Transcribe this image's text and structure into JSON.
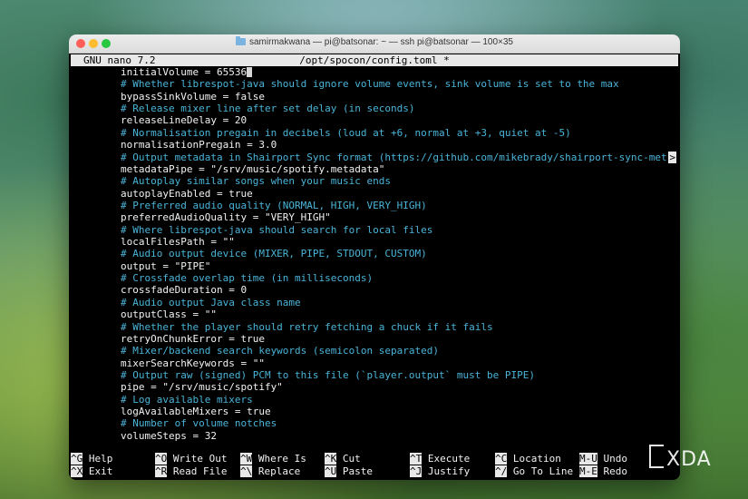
{
  "window": {
    "title": "samirmakwana — pi@batsonar: ~ — ssh pi@batsonar — 100×35"
  },
  "nano": {
    "version": "GNU nano 7.2",
    "filename": "/opt/spocon/config.toml *"
  },
  "lines": [
    {
      "text": "initialVolume = 65536",
      "type": "code",
      "cursor": true
    },
    {
      "text": "# Whether librespot-java should ignore volume events, sink volume is set to the max",
      "type": "comment"
    },
    {
      "text": "bypassSinkVolume = false",
      "type": "code"
    },
    {
      "text": "# Release mixer line after set delay (in seconds)",
      "type": "comment"
    },
    {
      "text": "releaseLineDelay = 20",
      "type": "code"
    },
    {
      "text": "# Normalisation pregain in decibels (loud at +6, normal at +3, quiet at -5)",
      "type": "comment"
    },
    {
      "text": "normalisationPregain = 3.0",
      "type": "code"
    },
    {
      "text": "# Output metadata in Shairport Sync format (https://github.com/mikebrady/shairport-sync-met",
      "type": "comment",
      "overflow": ">"
    },
    {
      "text": "metadataPipe = \"/srv/music/spotify.metadata\"",
      "type": "code"
    },
    {
      "text": "# Autoplay similar songs when your music ends",
      "type": "comment"
    },
    {
      "text": "autoplayEnabled = true",
      "type": "code"
    },
    {
      "text": "# Preferred audio quality (NORMAL, HIGH, VERY_HIGH)",
      "type": "comment"
    },
    {
      "text": "preferredAudioQuality = \"VERY_HIGH\"",
      "type": "code"
    },
    {
      "text": "# Where librespot-java should search for local files",
      "type": "comment"
    },
    {
      "text": "localFilesPath = \"\"",
      "type": "code"
    },
    {
      "text": "# Audio output device (MIXER, PIPE, STDOUT, CUSTOM)",
      "type": "comment"
    },
    {
      "text": "output = \"PIPE\"",
      "type": "code"
    },
    {
      "text": "# Crossfade overlap time (in milliseconds)",
      "type": "comment"
    },
    {
      "text": "crossfadeDuration = 0",
      "type": "code"
    },
    {
      "text": "# Audio output Java class name",
      "type": "comment"
    },
    {
      "text": "outputClass = \"\"",
      "type": "code"
    },
    {
      "text": "# Whether the player should retry fetching a chuck if it fails",
      "type": "comment"
    },
    {
      "text": "retryOnChunkError = true",
      "type": "code"
    },
    {
      "text": "# Mixer/backend search keywords (semicolon separated)",
      "type": "comment"
    },
    {
      "text": "mixerSearchKeywords = \"\"",
      "type": "code"
    },
    {
      "text": "# Output raw (signed) PCM to this file (`player.output` must be PIPE)",
      "type": "comment"
    },
    {
      "text": "pipe = \"/srv/music/spotify\"",
      "type": "code"
    },
    {
      "text": "# Log available mixers",
      "type": "comment"
    },
    {
      "text": "logAvailableMixers = true",
      "type": "code"
    },
    {
      "text": "# Number of volume notches",
      "type": "comment"
    },
    {
      "text": "volumeSteps = 32",
      "type": "code"
    }
  ],
  "shortcuts": [
    {
      "key": "^G",
      "label": "Help"
    },
    {
      "key": "^X",
      "label": "Exit"
    },
    {
      "key": "^O",
      "label": "Write Out"
    },
    {
      "key": "^R",
      "label": "Read File"
    },
    {
      "key": "^W",
      "label": "Where Is"
    },
    {
      "key": "^\\",
      "label": "Replace"
    },
    {
      "key": "^K",
      "label": "Cut"
    },
    {
      "key": "^U",
      "label": "Paste"
    },
    {
      "key": "^T",
      "label": "Execute"
    },
    {
      "key": "^J",
      "label": "Justify"
    },
    {
      "key": "^C",
      "label": "Location"
    },
    {
      "key": "^/",
      "label": "Go To Line"
    },
    {
      "key": "M-U",
      "label": "Undo"
    },
    {
      "key": "M-E",
      "label": "Redo"
    }
  ],
  "watermark": "XDA"
}
